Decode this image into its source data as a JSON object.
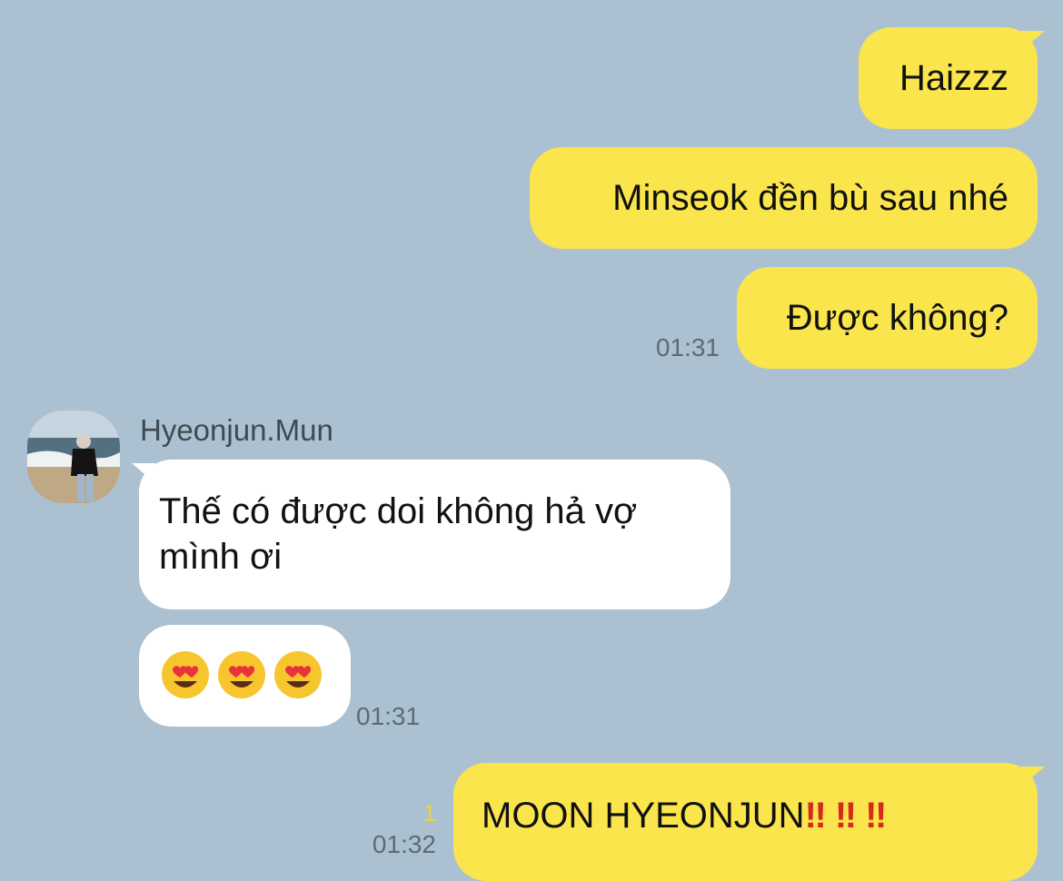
{
  "chat": {
    "messages": [
      {
        "text": "Haizzz"
      },
      {
        "text": "Minseok đền bù sau nhé"
      },
      {
        "text": "Được không?",
        "time": "01:31"
      },
      {
        "sender": "Hyeonjun.Mun",
        "text": "Thế có được doi không hả vợ mình ơi"
      },
      {
        "emojis": [
          "heart-eyes",
          "heart-eyes",
          "heart-eyes"
        ],
        "time": "01:31"
      },
      {
        "text": "MOON HYEONJUN",
        "emphasis": [
          "‼",
          "‼",
          "‼"
        ],
        "time": "01:32",
        "unread_count": "1"
      }
    ]
  },
  "colors": {
    "background": "#abc1d1",
    "outgoing_bubble": "#fae54d",
    "incoming_bubble": "#ffffff",
    "unread": "#f2d23a",
    "emphasis": "#d62a1b"
  }
}
